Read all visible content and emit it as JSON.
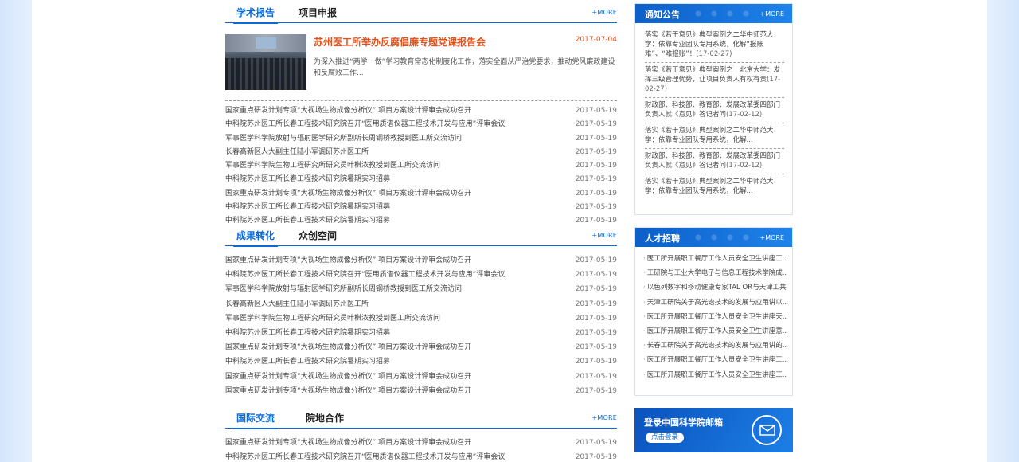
{
  "sections": [
    {
      "tabs": [
        "学术报告",
        "项目申报"
      ],
      "more": "+MORE",
      "feature": {
        "title": "苏州医工所举办反腐倡廉专题党课报告会",
        "date": "2017-07-04",
        "desc": "为深入推进“两学一做”学习教育常态化制度化工作，落实全面从严治党要求，推动党风廉政建设和反腐败工作..."
      },
      "items": [
        {
          "title": "国家重点研发计划专项“大视场生物成像分析仪” 项目方案设计评审会成功召开",
          "date": "2017-05-19"
        },
        {
          "title": "中科院苏州医工所长春工程技术研究院召开“医用质谱仪器工程技术开发与应用”评审会议",
          "date": "2017-05-19"
        },
        {
          "title": "军事医学科学院放射与辐射医学研究所副所长周钢桥教授到医工所交流访问",
          "date": "2017-05-19"
        },
        {
          "title": "长春高新区人大副主任陆小军调研苏州医工所",
          "date": "2017-05-19"
        },
        {
          "title": "军事医学科学院生物工程研究所研究员叶棋浓教授到医工所交流访问",
          "date": "2017-05-19"
        },
        {
          "title": "中科院苏州医工所长春工程技术研究院暑期实习招募",
          "date": "2017-05-19"
        },
        {
          "title": "国家重点研发计划专项“大视场生物成像分析仪” 项目方案设计评审会成功召开",
          "date": "2017-05-19"
        },
        {
          "title": "中科院苏州医工所长春工程技术研究院暑期实习招募",
          "date": "2017-05-19"
        },
        {
          "title": "中科院苏州医工所长春工程技术研究院暑期实习招募",
          "date": "2017-05-19"
        }
      ]
    },
    {
      "tabs": [
        "成果转化",
        "众创空间"
      ],
      "more": "+MORE",
      "items": [
        {
          "title": "国家重点研发计划专项“大视场生物成像分析仪” 项目方案设计评审会成功召开",
          "date": "2017-05-19"
        },
        {
          "title": "中科院苏州医工所长春工程技术研究院召开“医用质谱仪器工程技术开发与应用”评审会议",
          "date": "2017-05-19"
        },
        {
          "title": "军事医学科学院放射与辐射医学研究所副所长周钢桥教授到医工所交流访问",
          "date": "2017-05-19"
        },
        {
          "title": "长春高新区人大副主任陆小军调研苏州医工所",
          "date": "2017-05-19"
        },
        {
          "title": "军事医学科学院生物工程研究所研究员叶棋浓教授到医工所交流访问",
          "date": "2017-05-19"
        },
        {
          "title": "中科院苏州医工所长春工程技术研究院暑期实习招募",
          "date": "2017-05-19"
        },
        {
          "title": "国家重点研发计划专项“大视场生物成像分析仪” 项目方案设计评审会成功召开",
          "date": "2017-05-19"
        },
        {
          "title": "中科院苏州医工所长春工程技术研究院暑期实习招募",
          "date": "2017-05-19"
        },
        {
          "title": "国家重点研发计划专项“大视场生物成像分析仪” 项目方案设计评审会成功召开",
          "date": "2017-05-19"
        },
        {
          "title": "国家重点研发计划专项“大视场生物成像分析仪” 项目方案设计评审会成功召开",
          "date": "2017-05-19"
        }
      ]
    },
    {
      "tabs": [
        "国际交流",
        "院地合作"
      ],
      "more": "+MORE",
      "items": [
        {
          "title": "国家重点研发计划专项“大视场生物成像分析仪” 项目方案设计评审会成功召开",
          "date": "2017-05-19"
        },
        {
          "title": "中科院苏州医工所长春工程技术研究院召开“医用质谱仪器工程技术开发与应用”评审会议",
          "date": "2017-05-19"
        }
      ]
    }
  ],
  "notice": {
    "title": "通知公告",
    "more": "+MORE",
    "items": [
      {
        "text": "落实《若干意见》典型案例之二华中师范大学：依靠专业团队专用系统，化解“报账难”、“难报账”！",
        "date": "(17-02-27)"
      },
      {
        "text": "落实《若干意见》典型案例之一北京大学：发挥三级管理优势，让项目负责人有权有责",
        "date": "(17-02-27)"
      },
      {
        "text": "财政部、科技部、教育部、发展改革委四部门负责人就《意见》答记者问",
        "date": "(17-02-12)"
      },
      {
        "text": "落实《若干意见》典型案例之二华中师范大学：依靠专业团队专用系统，化解...",
        "date": ""
      },
      {
        "text": "财政部、科技部、教育部、发展改革委四部门负责人就《意见》答记者问",
        "date": "(17-02-12)"
      },
      {
        "text": "落实《若干意见》典型案例之二华中师范大学：依靠专业团队专用系统，化解...",
        "date": ""
      }
    ]
  },
  "jobs": {
    "title": "人才招聘",
    "more": "+MORE",
    "items": [
      "医工所开展职工餐厅工作人员安全卫生讲座工...",
      "工研院与工业大学电子与信息工程技术学院成...",
      "以色列数字和移动健康专家TAL OR与天津工共...",
      "天津工研院关于高光谱技术的发展与应用讲以...",
      "医工所开展职工餐厅工作人员安全卫生讲座天...",
      "医工所开展职工餐厅工作人员安全卫生讲座意...",
      "长春工研院关于高光谱技术的发展与应用讲的...",
      "医工所开展职工餐厅工作人员安全卫生讲座工...",
      "医工所开展职工餐厅工作人员安全卫生讲座工..."
    ]
  },
  "mail": {
    "title": "登录中国科学院邮箱",
    "button": "点击登录"
  }
}
